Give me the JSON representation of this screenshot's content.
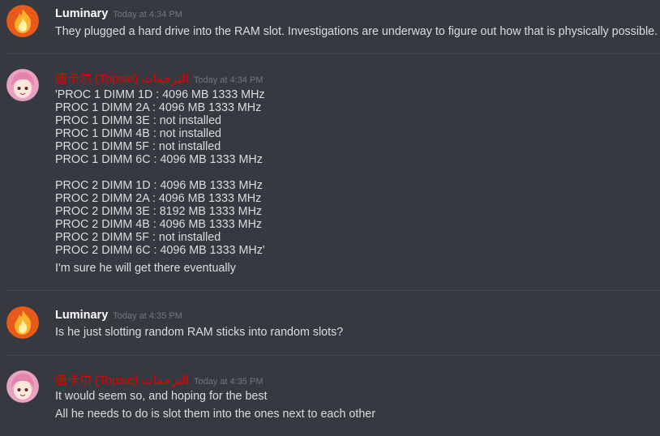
{
  "messages": [
    {
      "author": "Luminary",
      "timestamp": "Today at 4:34 PM",
      "lines": [
        "They plugged a hard drive into the RAM slot. Investigations are underway to figure out how that is physically possible."
      ]
    },
    {
      "author": "唐卡尔 (Topsie) الترجمات",
      "timestamp": "Today at 4:34 PM",
      "lines": [
        "'PROC 1 DIMM 1D : 4096 MB 1333 MHz",
        "PROC 1 DIMM 2A : 4096 MB 1333 MHz",
        "PROC 1 DIMM 3E : not installed",
        "PROC 1 DIMM 4B : not installed",
        "PROC 1 DIMM 5F : not installed",
        "PROC 1 DIMM 6C : 4096 MB 1333 MHz",
        "PROC 2 DIMM 1D : 4096 MB 1333 MHz",
        "PROC 2 DIMM 2A : 4096 MB 1333 MHz",
        "PROC 2 DIMM 3E : 8192 MB 1333 MHz",
        "PROC 2 DIMM 4B : 4096 MB 1333 MHz",
        "PROC 2 DIMM 5F : not installed",
        "PROC 2 DIMM 6C : 4096 MB 1333 MHz'",
        "I'm sure he will get there eventually"
      ]
    },
    {
      "author": "Luminary",
      "timestamp": "Today at 4:35 PM",
      "lines": [
        "Is he just slotting random RAM sticks into random slots?"
      ]
    },
    {
      "author": "唐卡尔 (Topsie) الترجمات",
      "timestamp": "Today at 4:35 PM",
      "lines": [
        "It would seem so, and hoping for the best",
        "All he needs to do is slot them into the ones next to each other"
      ]
    }
  ],
  "colors": {
    "background": "#36393f",
    "luminary_name": "#ffffff",
    "topsie_name": "#e60000",
    "timestamp": "#72767d",
    "text": "#dcddde"
  }
}
